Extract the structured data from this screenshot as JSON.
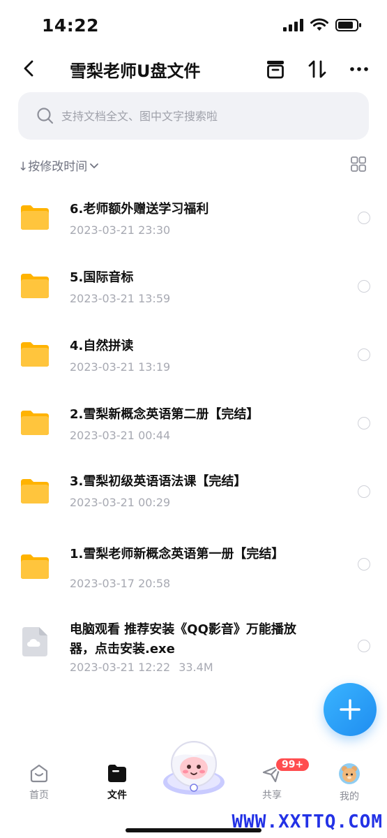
{
  "status_bar": {
    "time": "14:22"
  },
  "header": {
    "title": "雪梨老师U盘文件"
  },
  "search": {
    "placeholder": "支持文档全文、图中文字搜索啦"
  },
  "sort": {
    "label": "↓按修改时间"
  },
  "files": [
    {
      "name": "6.老师额外赠送学习福利",
      "date": "2023-03-21 23:30",
      "size": "",
      "type": "folder"
    },
    {
      "name": "5.国际音标",
      "date": "2023-03-21 13:59",
      "size": "",
      "type": "folder"
    },
    {
      "name": "4.自然拼读",
      "date": "2023-03-21 13:19",
      "size": "",
      "type": "folder"
    },
    {
      "name": "2.雪梨新概念英语第二册【完结】",
      "date": "2023-03-21 00:44",
      "size": "",
      "type": "folder"
    },
    {
      "name": "3.雪梨初级英语语法课【完结】",
      "date": "2023-03-21 00:29",
      "size": "",
      "type": "folder"
    },
    {
      "name": "1.雪梨老师新概念英语第一册【完结】",
      "date": "2023-03-17 20:58",
      "size": "",
      "type": "folder"
    },
    {
      "name": "电脑观看 推荐安装《QQ影音》万能播放器，点击安装.exe",
      "date": "2023-03-21 12:22",
      "size": "33.4M",
      "type": "file"
    }
  ],
  "nav": {
    "home": "首页",
    "files": "文件",
    "share": "共享",
    "share_badge": "99+",
    "mine": "我的"
  },
  "watermark": "WWW.XXTTQ.COM",
  "colors": {
    "folder": "#ffc53d",
    "accent": "#1f8df0",
    "badge": "#ff4d4f"
  }
}
